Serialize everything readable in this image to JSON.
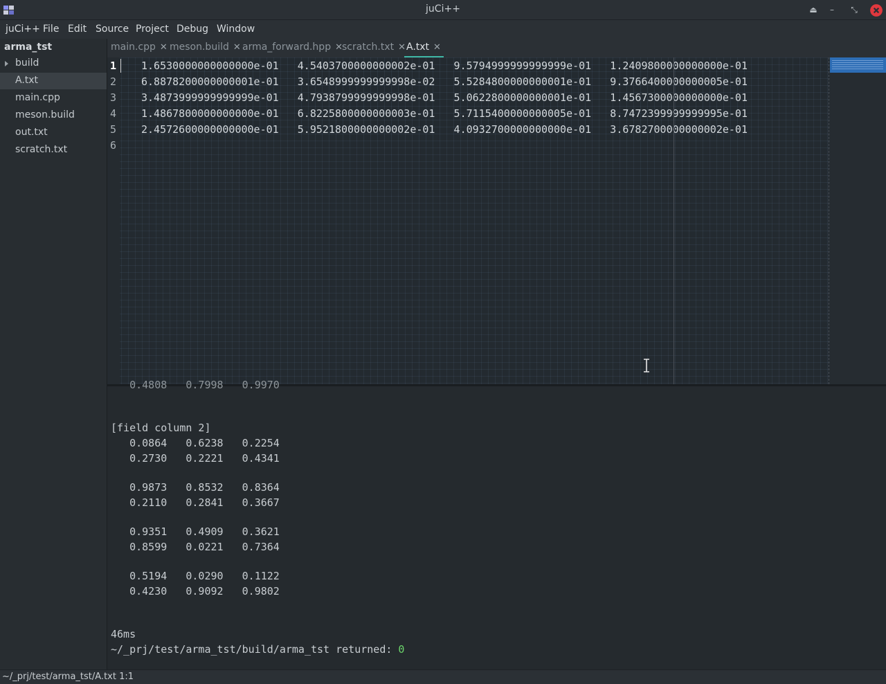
{
  "window": {
    "title": "juCi++"
  },
  "menu": [
    "juCi++",
    "File",
    "Edit",
    "Source",
    "Project",
    "Debug",
    "Window"
  ],
  "sidebar": {
    "project": "arma_tst",
    "items": [
      {
        "label": "build",
        "icon": "chevron-right-icon"
      },
      {
        "label": "A.txt",
        "selected": true
      },
      {
        "label": "main.cpp"
      },
      {
        "label": "meson.build"
      },
      {
        "label": "out.txt"
      },
      {
        "label": "scratch.txt"
      }
    ]
  },
  "tabs": [
    {
      "label": "main.cpp",
      "close": "✕"
    },
    {
      "label": "meson.build",
      "close": "✕"
    },
    {
      "label": "arma_forward.hpp",
      "close": "✕"
    },
    {
      "label": "scratch.txt",
      "close": "✕"
    },
    {
      "label": "A.txt",
      "close": "✕",
      "active": true
    }
  ],
  "editor": {
    "line_numbers": [
      "1",
      "2",
      "3",
      "4",
      "5",
      "6"
    ],
    "lines": [
      "1.6530000000000000e-01   4.5403700000000002e-01   9.5794999999999999e-01   1.2409800000000000e-01",
      "6.8878200000000001e-01   3.6548999999999998e-02   5.5284800000000001e-01   9.3766400000000005e-01",
      "3.4873999999999999e-01   4.7938799999999998e-01   5.0622800000000001e-01   1.4567300000000000e-01",
      "1.4867800000000000e-01   6.8225800000000003e-01   5.7115400000000005e-01   8.7472399999999995e-01",
      "2.4572600000000000e-01   5.9521800000000002e-01   4.0932700000000000e-01   3.6782700000000002e-01",
      ""
    ]
  },
  "terminal": {
    "partial_line": "   0.4808   0.7998   0.9970",
    "lines": [
      "[field column 2]",
      "   0.0864   0.6238   0.2254",
      "   0.2730   0.2221   0.4341",
      "",
      "   0.9873   0.8532   0.8364",
      "   0.2110   0.2841   0.3667",
      "",
      "   0.9351   0.4909   0.3621",
      "   0.8599   0.0221   0.7364",
      "",
      "   0.5194   0.0290   0.1122",
      "   0.4230   0.9092   0.9802",
      "",
      "",
      "46ms"
    ],
    "return_prefix": "~/_prj/test/arma_tst/build/arma_tst returned: ",
    "return_code": "0"
  },
  "status": {
    "path": "~/_prj/test/arma_tst/A.txt 1:1"
  },
  "colors": {
    "accent": "#3fb7a5",
    "close": "#e0383e",
    "return_ok": "#6bd46b",
    "minimap": "#2d6db5"
  }
}
